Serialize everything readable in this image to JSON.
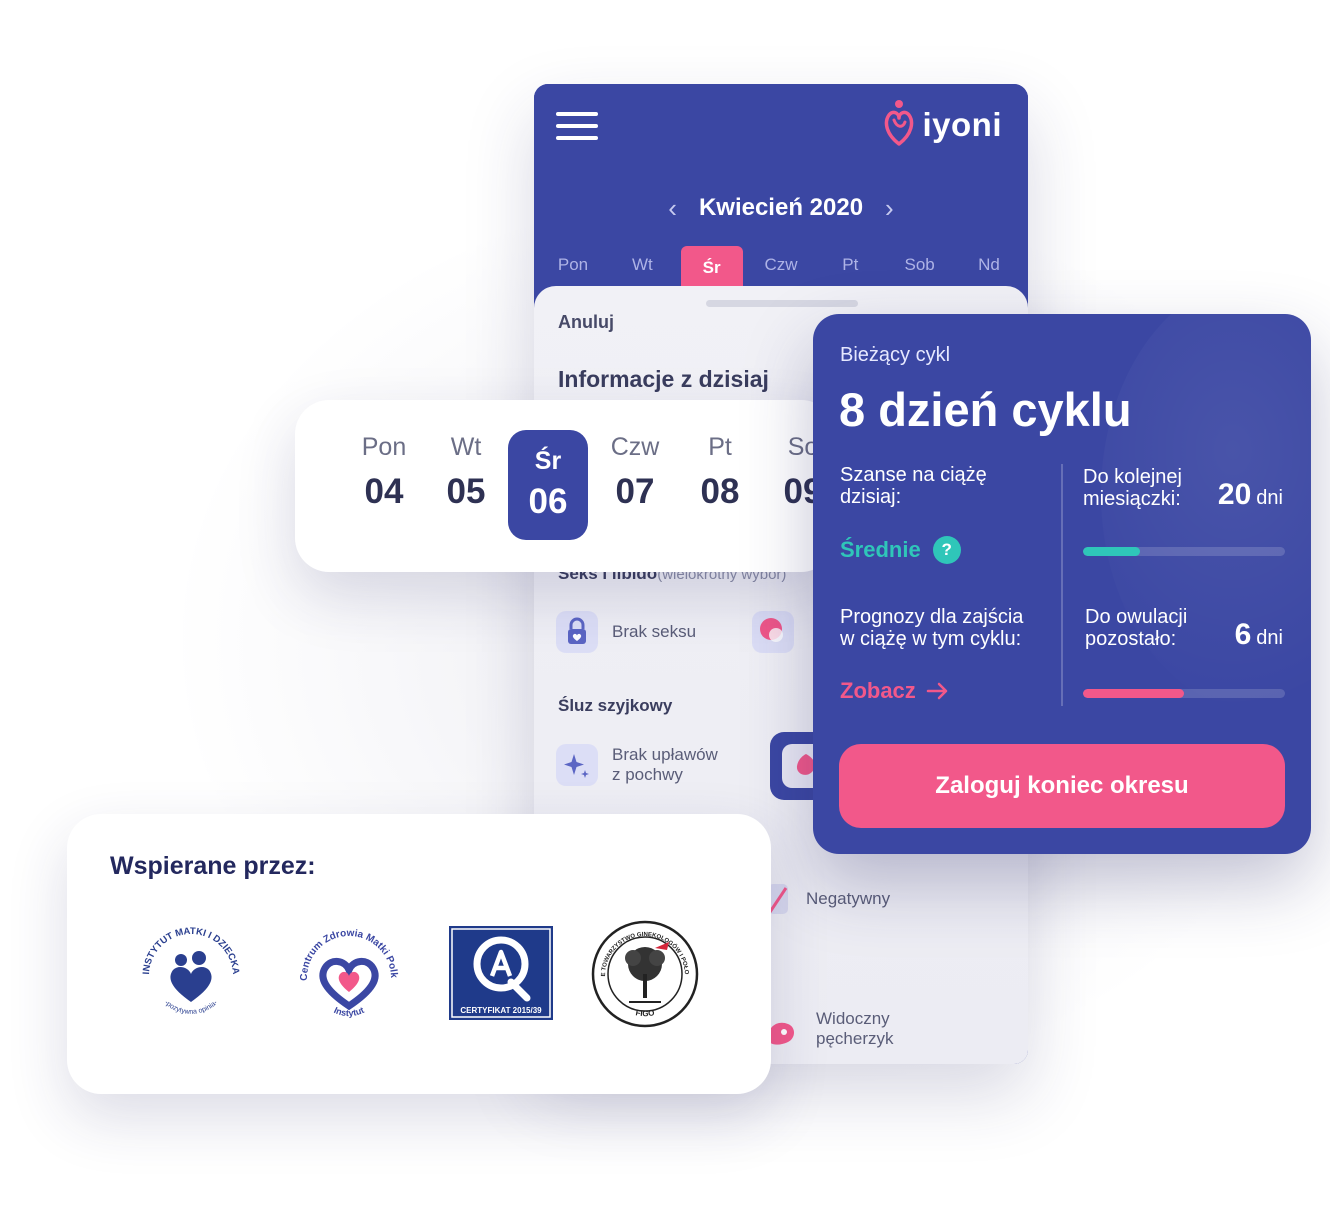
{
  "phone": {
    "brand": "iyoni",
    "month": "Kwiecień 2020",
    "days": [
      "Pon",
      "Wt",
      "Śr",
      "Czw",
      "Pt",
      "Sob",
      "Nd"
    ],
    "active_day_index": 2,
    "cancel_label": "Anuluj",
    "sheet_title": "Informacje z dzisiaj",
    "sex_section_title": "Seks i libido",
    "sex_section_hint": "(wielokrotny wybór)",
    "sex_option_1": "Brak seksu",
    "mucus_section_title": "Śluz szyjkowy",
    "mucus_option_1_line1": "Brak upławów",
    "mucus_option_1_line2": "z pochwy",
    "test_option": "Negatywny",
    "ovulation_option_line1": "Widoczny",
    "ovulation_option_line2": "pęcherzyk"
  },
  "week": {
    "days": [
      {
        "name": "Pon",
        "num": "04"
      },
      {
        "name": "Wt",
        "num": "05"
      },
      {
        "name": "Śr",
        "num": "06"
      },
      {
        "name": "Czw",
        "num": "07"
      },
      {
        "name": "Pt",
        "num": "08"
      },
      {
        "name": "So",
        "num": "09"
      }
    ],
    "selected_index": 2
  },
  "cycle": {
    "subtitle": "Bieżący cykl",
    "title": "8 dzień cyklu",
    "chance_label_line1": "Szanse na ciążę",
    "chance_label_line2": "dzisiaj:",
    "chance_value": "Średnie",
    "chance_help": "?",
    "next_period_label_line1": "Do kolejnej",
    "next_period_label_line2": "miesiączki:",
    "next_period_days": "20",
    "next_period_unit": "dni",
    "next_period_progress": 0.28,
    "forecast_label_line1": "Prognozy dla zajścia",
    "forecast_label_line2": "w ciążę w tym cyklu:",
    "forecast_link": "Zobacz",
    "ovulation_label_line1": "Do owulacji",
    "ovulation_label_line2": "pozostało:",
    "ovulation_days": "6",
    "ovulation_unit": "dni",
    "ovulation_progress": 0.5,
    "log_button": "Zaloguj koniec okresu"
  },
  "support": {
    "title": "Wspierane przez:",
    "badge_1_top": "INSTYTUT MATKI I DZIECKA",
    "badge_1_bottom": "-pozytywna opinia-",
    "badge_2_top": "Centrum Zdrowia Matki Polki",
    "badge_2_bottom": "Instytut",
    "badge_3_text": "CERTYFIKAT 2015/39",
    "badge_4_top": "POLSKIE TOWARZYSTWO GINEKOLOGÓW I POŁOŻNIKÓW",
    "badge_4_bottom": "FIGO"
  },
  "colors": {
    "primary": "#3b47a3",
    "accent_pink": "#f2588a",
    "accent_teal": "#2fc6b9"
  },
  "icons": [
    "menu-icon",
    "chevron-left-icon",
    "chevron-right-icon",
    "lock-heart-icon",
    "sparkle-icon",
    "arrow-right-icon",
    "help-icon"
  ]
}
